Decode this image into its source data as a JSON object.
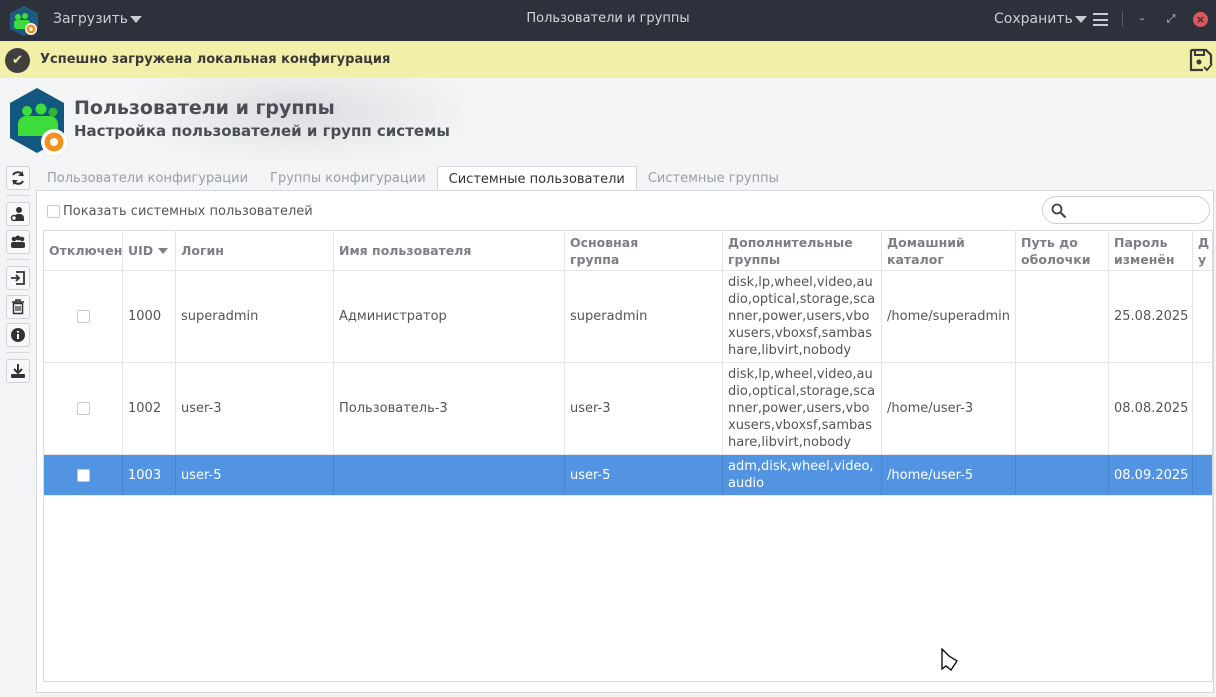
{
  "titlebar": {
    "load_menu": "Загрузить",
    "title": "Пользователи и группы",
    "save_menu": "Сохранить"
  },
  "banner": {
    "message": "Успешно загружена локальная конфигурация"
  },
  "header": {
    "title": "Пользователи и группы",
    "subtitle": "Настройка пользователей и групп системы"
  },
  "tabs": [
    {
      "label": "Пользователи конфигурации"
    },
    {
      "label": "Группы конфигурации"
    },
    {
      "label": "Системные пользователи",
      "active": true
    },
    {
      "label": "Системные группы"
    }
  ],
  "panel": {
    "show_system_label": "Показать системных пользователей",
    "search_placeholder": ""
  },
  "table": {
    "columns": [
      "Отключен",
      "UID",
      "Логин",
      "Имя пользователя",
      "Основная группа",
      "Дополнительные группы",
      "Домашний каталог",
      "Путь до оболочки",
      "Пароль изменён",
      "Д у"
    ],
    "rows": [
      {
        "disabled": false,
        "uid": "1000",
        "login": "superadmin",
        "name": "Администратор",
        "group": "superadmin",
        "extra": "disk,lp,wheel,video,audio,optical,storage,scanner,power,users,vboxusers,vboxsf,sambashare,libvirt,nobody",
        "home": "/home/superadmin",
        "shell": "",
        "pwchanged": "25.08.2025"
      },
      {
        "disabled": false,
        "uid": "1002",
        "login": "user-3",
        "name": "Пользователь-3",
        "group": "user-3",
        "extra": "disk,lp,wheel,video,audio,optical,storage,scanner,power,users,vboxusers,vboxsf,sambashare,libvirt,nobody",
        "home": "/home/user-3",
        "shell": "",
        "pwchanged": "08.08.2025"
      },
      {
        "disabled": false,
        "uid": "1003",
        "login": "user-5",
        "name": "",
        "group": "user-5",
        "extra": "adm,disk,wheel,video,audio",
        "home": "/home/user-5",
        "shell": "",
        "pwchanged": "08.09.2025",
        "selected": true
      }
    ]
  },
  "colors": {
    "titlebar": "#2c313c",
    "banner": "#f2efa9",
    "selection": "#5294e2",
    "close": "#e0575b"
  }
}
